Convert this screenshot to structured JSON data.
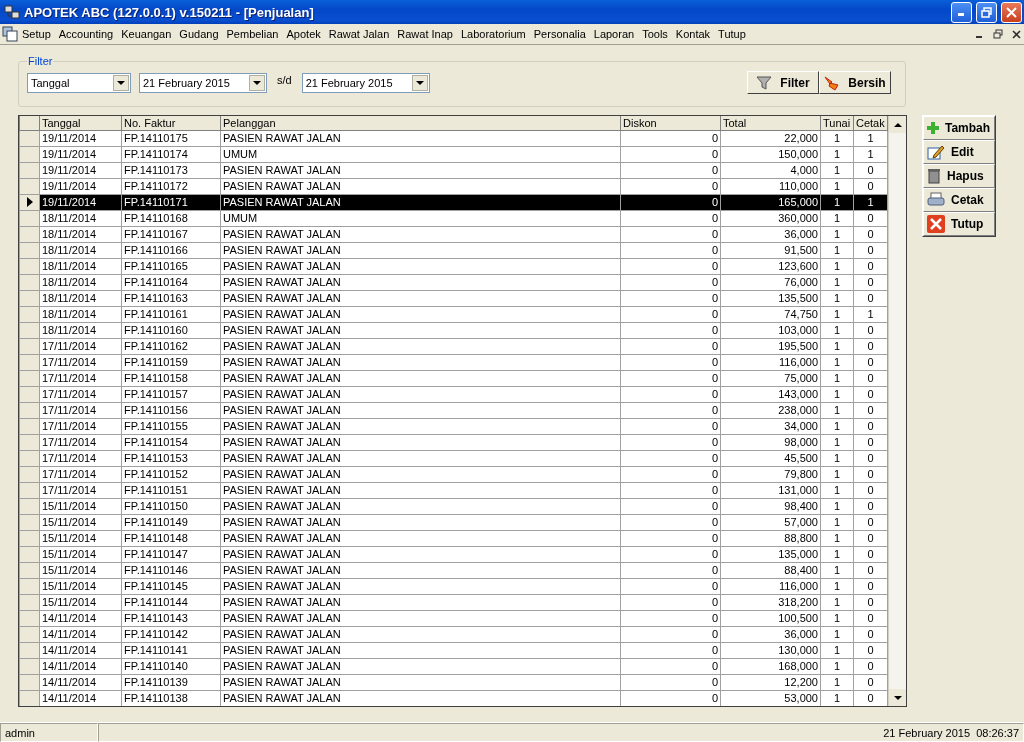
{
  "window": {
    "title": "APOTEK ABC (127.0.0.1) v.150211 - [Penjualan]"
  },
  "menu": [
    "Setup",
    "Accounting",
    "Keuangan",
    "Gudang",
    "Pembelian",
    "Apotek",
    "Rawat Jalan",
    "Rawat Inap",
    "Laboratorium",
    "Personalia",
    "Laporan",
    "Tools",
    "Kontak",
    "Tutup"
  ],
  "filter": {
    "title": "Filter",
    "field": "Tanggal",
    "date_from": "21 February 2015",
    "separator": "s/d",
    "date_to": "21 February 2015",
    "buttons": [
      {
        "kind": "filter",
        "label": "Filter"
      },
      {
        "kind": "clear",
        "label": "Bersih"
      }
    ]
  },
  "table": {
    "columns": [
      "Tanggal",
      "No. Faktur",
      "Pelanggan",
      "Diskon",
      "Total",
      "Tunai",
      "Cetak"
    ],
    "rows": [
      {
        "tanggal": "19/11/2014",
        "no_faktur": "FP.14110175",
        "pelanggan": "PASIEN RAWAT JALAN",
        "diskon": "0",
        "total": "22,000",
        "tunai": "1",
        "cetak": "1",
        "selected": false
      },
      {
        "tanggal": "19/11/2014",
        "no_faktur": "FP.14110174",
        "pelanggan": "UMUM",
        "diskon": "0",
        "total": "150,000",
        "tunai": "1",
        "cetak": "1",
        "selected": false
      },
      {
        "tanggal": "19/11/2014",
        "no_faktur": "FP.14110173",
        "pelanggan": "PASIEN RAWAT JALAN",
        "diskon": "0",
        "total": "4,000",
        "tunai": "1",
        "cetak": "0",
        "selected": false
      },
      {
        "tanggal": "19/11/2014",
        "no_faktur": "FP.14110172",
        "pelanggan": "PASIEN RAWAT JALAN",
        "diskon": "0",
        "total": "110,000",
        "tunai": "1",
        "cetak": "0",
        "selected": false
      },
      {
        "tanggal": "19/11/2014",
        "no_faktur": "FP.14110171",
        "pelanggan": "PASIEN RAWAT JALAN",
        "diskon": "0",
        "total": "165,000",
        "tunai": "1",
        "cetak": "1",
        "selected": true
      },
      {
        "tanggal": "18/11/2014",
        "no_faktur": "FP.14110168",
        "pelanggan": "UMUM",
        "diskon": "0",
        "total": "360,000",
        "tunai": "1",
        "cetak": "0",
        "selected": false
      },
      {
        "tanggal": "18/11/2014",
        "no_faktur": "FP.14110167",
        "pelanggan": "PASIEN RAWAT JALAN",
        "diskon": "0",
        "total": "36,000",
        "tunai": "1",
        "cetak": "0",
        "selected": false
      },
      {
        "tanggal": "18/11/2014",
        "no_faktur": "FP.14110166",
        "pelanggan": "PASIEN RAWAT JALAN",
        "diskon": "0",
        "total": "91,500",
        "tunai": "1",
        "cetak": "0",
        "selected": false
      },
      {
        "tanggal": "18/11/2014",
        "no_faktur": "FP.14110165",
        "pelanggan": "PASIEN RAWAT JALAN",
        "diskon": "0",
        "total": "123,600",
        "tunai": "1",
        "cetak": "0",
        "selected": false
      },
      {
        "tanggal": "18/11/2014",
        "no_faktur": "FP.14110164",
        "pelanggan": "PASIEN RAWAT JALAN",
        "diskon": "0",
        "total": "76,000",
        "tunai": "1",
        "cetak": "0",
        "selected": false
      },
      {
        "tanggal": "18/11/2014",
        "no_faktur": "FP.14110163",
        "pelanggan": "PASIEN RAWAT JALAN",
        "diskon": "0",
        "total": "135,500",
        "tunai": "1",
        "cetak": "0",
        "selected": false
      },
      {
        "tanggal": "18/11/2014",
        "no_faktur": "FP.14110161",
        "pelanggan": "PASIEN RAWAT JALAN",
        "diskon": "0",
        "total": "74,750",
        "tunai": "1",
        "cetak": "1",
        "selected": false
      },
      {
        "tanggal": "18/11/2014",
        "no_faktur": "FP.14110160",
        "pelanggan": "PASIEN RAWAT JALAN",
        "diskon": "0",
        "total": "103,000",
        "tunai": "1",
        "cetak": "0",
        "selected": false
      },
      {
        "tanggal": "17/11/2014",
        "no_faktur": "FP.14110162",
        "pelanggan": "PASIEN RAWAT JALAN",
        "diskon": "0",
        "total": "195,500",
        "tunai": "1",
        "cetak": "0",
        "selected": false
      },
      {
        "tanggal": "17/11/2014",
        "no_faktur": "FP.14110159",
        "pelanggan": "PASIEN RAWAT JALAN",
        "diskon": "0",
        "total": "116,000",
        "tunai": "1",
        "cetak": "0",
        "selected": false
      },
      {
        "tanggal": "17/11/2014",
        "no_faktur": "FP.14110158",
        "pelanggan": "PASIEN RAWAT JALAN",
        "diskon": "0",
        "total": "75,000",
        "tunai": "1",
        "cetak": "0",
        "selected": false
      },
      {
        "tanggal": "17/11/2014",
        "no_faktur": "FP.14110157",
        "pelanggan": "PASIEN RAWAT JALAN",
        "diskon": "0",
        "total": "143,000",
        "tunai": "1",
        "cetak": "0",
        "selected": false
      },
      {
        "tanggal": "17/11/2014",
        "no_faktur": "FP.14110156",
        "pelanggan": "PASIEN RAWAT JALAN",
        "diskon": "0",
        "total": "238,000",
        "tunai": "1",
        "cetak": "0",
        "selected": false
      },
      {
        "tanggal": "17/11/2014",
        "no_faktur": "FP.14110155",
        "pelanggan": "PASIEN RAWAT JALAN",
        "diskon": "0",
        "total": "34,000",
        "tunai": "1",
        "cetak": "0",
        "selected": false
      },
      {
        "tanggal": "17/11/2014",
        "no_faktur": "FP.14110154",
        "pelanggan": "PASIEN RAWAT JALAN",
        "diskon": "0",
        "total": "98,000",
        "tunai": "1",
        "cetak": "0",
        "selected": false
      },
      {
        "tanggal": "17/11/2014",
        "no_faktur": "FP.14110153",
        "pelanggan": "PASIEN RAWAT JALAN",
        "diskon": "0",
        "total": "45,500",
        "tunai": "1",
        "cetak": "0",
        "selected": false
      },
      {
        "tanggal": "17/11/2014",
        "no_faktur": "FP.14110152",
        "pelanggan": "PASIEN RAWAT JALAN",
        "diskon": "0",
        "total": "79,800",
        "tunai": "1",
        "cetak": "0",
        "selected": false
      },
      {
        "tanggal": "17/11/2014",
        "no_faktur": "FP.14110151",
        "pelanggan": "PASIEN RAWAT JALAN",
        "diskon": "0",
        "total": "131,000",
        "tunai": "1",
        "cetak": "0",
        "selected": false
      },
      {
        "tanggal": "15/11/2014",
        "no_faktur": "FP.14110150",
        "pelanggan": "PASIEN RAWAT JALAN",
        "diskon": "0",
        "total": "98,400",
        "tunai": "1",
        "cetak": "0",
        "selected": false
      },
      {
        "tanggal": "15/11/2014",
        "no_faktur": "FP.14110149",
        "pelanggan": "PASIEN RAWAT JALAN",
        "diskon": "0",
        "total": "57,000",
        "tunai": "1",
        "cetak": "0",
        "selected": false
      },
      {
        "tanggal": "15/11/2014",
        "no_faktur": "FP.14110148",
        "pelanggan": "PASIEN RAWAT JALAN",
        "diskon": "0",
        "total": "88,800",
        "tunai": "1",
        "cetak": "0",
        "selected": false
      },
      {
        "tanggal": "15/11/2014",
        "no_faktur": "FP.14110147",
        "pelanggan": "PASIEN RAWAT JALAN",
        "diskon": "0",
        "total": "135,000",
        "tunai": "1",
        "cetak": "0",
        "selected": false
      },
      {
        "tanggal": "15/11/2014",
        "no_faktur": "FP.14110146",
        "pelanggan": "PASIEN RAWAT JALAN",
        "diskon": "0",
        "total": "88,400",
        "tunai": "1",
        "cetak": "0",
        "selected": false
      },
      {
        "tanggal": "15/11/2014",
        "no_faktur": "FP.14110145",
        "pelanggan": "PASIEN RAWAT JALAN",
        "diskon": "0",
        "total": "116,000",
        "tunai": "1",
        "cetak": "0",
        "selected": false
      },
      {
        "tanggal": "15/11/2014",
        "no_faktur": "FP.14110144",
        "pelanggan": "PASIEN RAWAT JALAN",
        "diskon": "0",
        "total": "318,200",
        "tunai": "1",
        "cetak": "0",
        "selected": false
      },
      {
        "tanggal": "14/11/2014",
        "no_faktur": "FP.14110143",
        "pelanggan": "PASIEN RAWAT JALAN",
        "diskon": "0",
        "total": "100,500",
        "tunai": "1",
        "cetak": "0",
        "selected": false
      },
      {
        "tanggal": "14/11/2014",
        "no_faktur": "FP.14110142",
        "pelanggan": "PASIEN RAWAT JALAN",
        "diskon": "0",
        "total": "36,000",
        "tunai": "1",
        "cetak": "0",
        "selected": false
      },
      {
        "tanggal": "14/11/2014",
        "no_faktur": "FP.14110141",
        "pelanggan": "PASIEN RAWAT JALAN",
        "diskon": "0",
        "total": "130,000",
        "tunai": "1",
        "cetak": "0",
        "selected": false
      },
      {
        "tanggal": "14/11/2014",
        "no_faktur": "FP.14110140",
        "pelanggan": "PASIEN RAWAT JALAN",
        "diskon": "0",
        "total": "168,000",
        "tunai": "1",
        "cetak": "0",
        "selected": false
      },
      {
        "tanggal": "14/11/2014",
        "no_faktur": "FP.14110139",
        "pelanggan": "PASIEN RAWAT JALAN",
        "diskon": "0",
        "total": "12,200",
        "tunai": "1",
        "cetak": "0",
        "selected": false
      },
      {
        "tanggal": "14/11/2014",
        "no_faktur": "FP.14110138",
        "pelanggan": "PASIEN RAWAT JALAN",
        "diskon": "0",
        "total": "53,000",
        "tunai": "1",
        "cetak": "0",
        "selected": false
      }
    ]
  },
  "actions": [
    {
      "kind": "add",
      "label": "Tambah"
    },
    {
      "kind": "edit",
      "label": "Edit"
    },
    {
      "kind": "delete",
      "label": "Hapus"
    },
    {
      "kind": "print",
      "label": "Cetak"
    },
    {
      "kind": "close",
      "label": "Tutup"
    }
  ],
  "status_bar": {
    "user": "admin",
    "datetime": "21 February 2015  08:26:37"
  }
}
